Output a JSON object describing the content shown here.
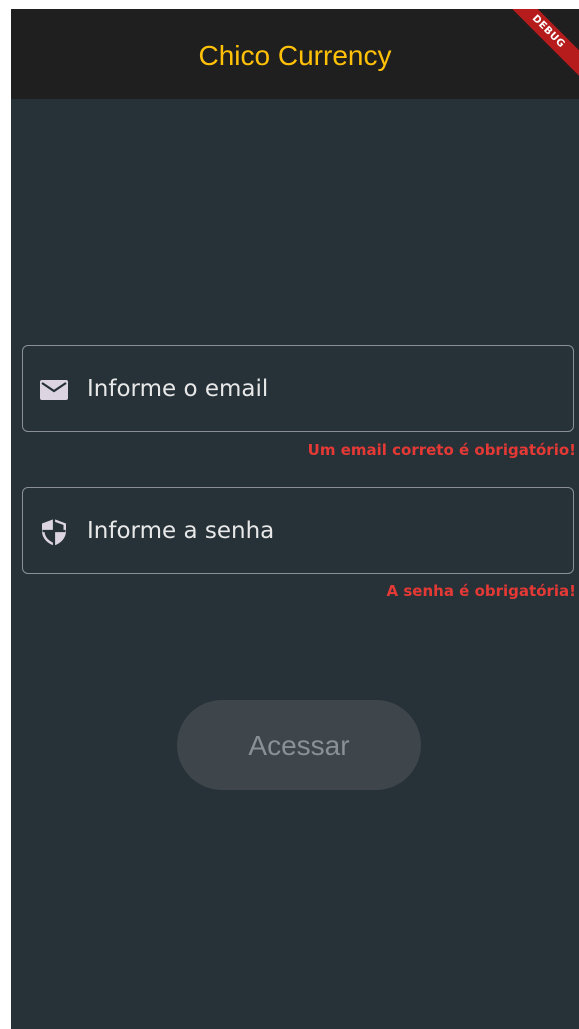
{
  "appbar": {
    "title": "Chico Currency",
    "debug_banner": "DEBUG"
  },
  "form": {
    "email": {
      "icon": "mail-icon",
      "placeholder": "Informe o email",
      "value": "",
      "error": "Um email correto é obrigatório!"
    },
    "password": {
      "icon": "shield-icon",
      "placeholder": "Informe a senha",
      "value": "",
      "error": "A senha é obrigatória!"
    },
    "submit_label": "Acessar"
  },
  "colors": {
    "background": "#263238",
    "appbar": "#1f1f1f",
    "title": "#ffc107",
    "error": "#e53935",
    "button_disabled": "#3e464c"
  }
}
